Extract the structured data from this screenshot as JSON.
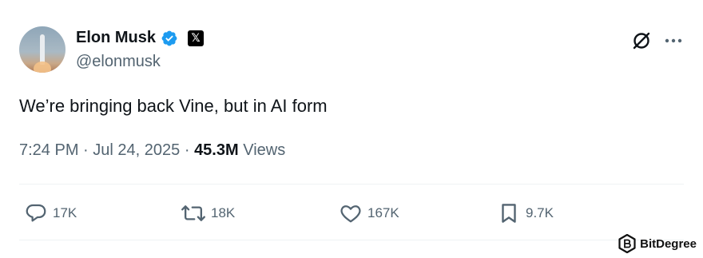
{
  "author": {
    "name": "Elon Musk",
    "handle": "@elonmusk",
    "verified_color": "#1d9bf0",
    "affiliate_badge": "𝕏"
  },
  "tweet": {
    "text": "We’re bringing back Vine, but in AI form",
    "time": "7:24 PM",
    "date": "Jul 24, 2025",
    "views_count": "45.3M",
    "views_label": "Views",
    "separator": "·"
  },
  "actions": {
    "replies": "17K",
    "reposts": "18K",
    "likes": "167K",
    "bookmarks": "9.7K"
  },
  "watermark": {
    "text": "BitDegree"
  },
  "icons": {
    "top_right": [
      "grok-icon",
      "more-icon"
    ]
  }
}
